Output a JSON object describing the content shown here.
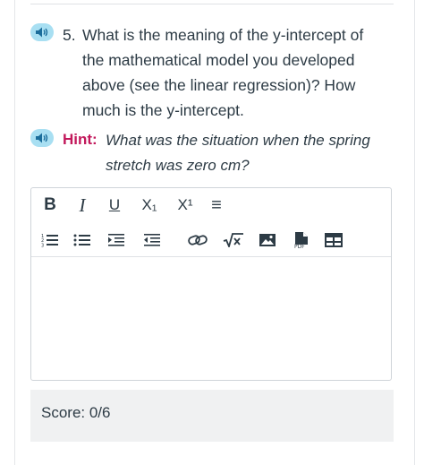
{
  "question": {
    "number": "5.",
    "text": "What is the meaning of the y-intercept of the mathematical model you developed above (see the linear regression)? How much is the y-intercept.",
    "audio_icon": "speaker-icon"
  },
  "hint": {
    "label": "Hint:",
    "text": "What was the situation when the spring stretch was zero cm?",
    "label_color": "#c2185b",
    "audio_icon": "speaker-icon"
  },
  "editor": {
    "toolbar_row1": [
      {
        "name": "bold-button",
        "glyph": "B"
      },
      {
        "name": "italic-button",
        "glyph": "I"
      },
      {
        "name": "underline-button",
        "glyph": "U"
      },
      {
        "name": "subscript-button",
        "glyph": "X₁"
      },
      {
        "name": "superscript-button",
        "glyph": "X¹"
      },
      {
        "name": "more-options-button",
        "glyph": "≡"
      }
    ],
    "toolbar_row2": [
      {
        "name": "numbered-list-button",
        "icon": "numbered-list-icon"
      },
      {
        "name": "bullet-list-button",
        "icon": "bullet-list-icon"
      },
      {
        "name": "indent-button",
        "icon": "indent-icon"
      },
      {
        "name": "outdent-button",
        "icon": "outdent-icon"
      },
      {
        "name": "link-button",
        "icon": "link-icon"
      },
      {
        "name": "math-button",
        "icon": "square-root-icon"
      },
      {
        "name": "image-button",
        "icon": "image-icon"
      },
      {
        "name": "pdf-button",
        "icon": "pdf-icon",
        "glyph": "PDF"
      },
      {
        "name": "table-button",
        "icon": "table-icon"
      }
    ],
    "value": ""
  },
  "score": {
    "text": "Score: 0/6"
  },
  "colors": {
    "speaker_bg": "#a8dff2",
    "speaker_fg": "#1a6d9b",
    "hint": "#c2185b",
    "text": "#2d3b45",
    "score_bg": "#f0f1f2"
  }
}
